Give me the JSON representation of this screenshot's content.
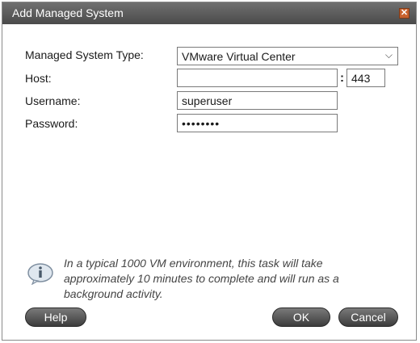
{
  "dialog": {
    "title": "Add Managed System",
    "close_icon": "close-icon"
  },
  "form": {
    "type_label": "Managed System Type:",
    "type_value": "VMware Virtual Center",
    "host_label": "Host:",
    "host_value": "",
    "port_separator": ":",
    "port_value": "443",
    "username_label": "Username:",
    "username_value": "superuser",
    "password_label": "Password:",
    "password_value": "••••••••"
  },
  "info": {
    "icon": "info-icon",
    "text": "In a typical 1000 VM environment, this task will take approximately 10 minutes to complete and will run as a background activity."
  },
  "buttons": {
    "help": "Help",
    "ok": "OK",
    "cancel": "Cancel"
  }
}
